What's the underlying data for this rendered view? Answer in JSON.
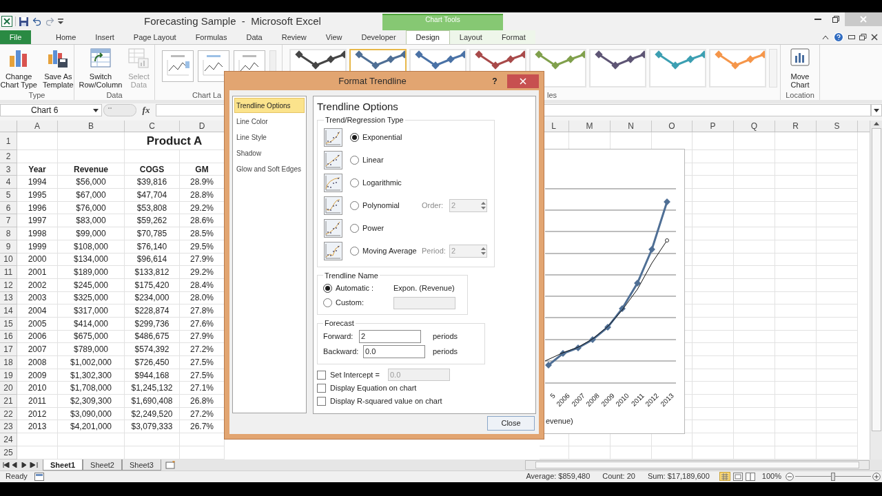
{
  "window": {
    "title": "Forecasting Sample  -  Microsoft Excel",
    "contextual_label": "Chart Tools"
  },
  "ribbon": {
    "tabs": [
      {
        "label": "File",
        "kind": "file",
        "selected": false
      },
      {
        "label": "Home",
        "kind": "plain",
        "selected": false
      },
      {
        "label": "Insert",
        "kind": "plain",
        "selected": false
      },
      {
        "label": "Page Layout",
        "kind": "plain",
        "selected": false
      },
      {
        "label": "Formulas",
        "kind": "plain",
        "selected": false
      },
      {
        "label": "Data",
        "kind": "plain",
        "selected": false
      },
      {
        "label": "Review",
        "kind": "plain",
        "selected": false
      },
      {
        "label": "View",
        "kind": "plain",
        "selected": false
      },
      {
        "label": "Developer",
        "kind": "plain",
        "selected": false
      },
      {
        "label": "Design",
        "kind": "contextual",
        "selected": true
      },
      {
        "label": "Layout",
        "kind": "contextual",
        "selected": false
      },
      {
        "label": "Format",
        "kind": "contextual",
        "selected": false
      }
    ],
    "groups": [
      {
        "label": "Type",
        "kind": "buttons",
        "buttons": [
          {
            "lines": [
              "Change",
              "Chart Type"
            ],
            "disabled": false
          },
          {
            "lines": [
              "Save As",
              "Template"
            ],
            "disabled": false
          }
        ]
      },
      {
        "label": "Data",
        "kind": "buttons",
        "buttons": [
          {
            "lines": [
              "Switch",
              "Row/Column"
            ],
            "disabled": false
          },
          {
            "lines": [
              "Select",
              "Data"
            ],
            "disabled": true
          }
        ]
      },
      {
        "label": "Chart La",
        "kind": "layouts"
      },
      {
        "label": "les",
        "kind": "styles",
        "styles": [
          {
            "color": "#454545",
            "selected": false
          },
          {
            "color": "#4f6f95",
            "selected": true
          },
          {
            "color": "#4a72a6",
            "selected": false
          },
          {
            "color": "#a84a4a",
            "selected": false
          },
          {
            "color": "#80a04c",
            "selected": false
          },
          {
            "color": "#5e5575",
            "selected": false
          },
          {
            "color": "#3c9fb2",
            "selected": false
          },
          {
            "color": "#f5964a",
            "selected": false
          }
        ]
      },
      {
        "label": "Location",
        "kind": "buttons",
        "buttons": [
          {
            "lines": [
              "Move",
              "Chart"
            ],
            "disabled": false
          }
        ]
      }
    ]
  },
  "formula_bar": {
    "name_box": "Chart 6",
    "function_label": "fx"
  },
  "sheet": {
    "columns_left": [
      "A",
      "B",
      "C",
      "D"
    ],
    "columns_right": [
      "L",
      "M",
      "N",
      "O",
      "P",
      "Q",
      "R",
      "S"
    ],
    "row_numbers": [
      "1",
      "2",
      "3",
      "4",
      "5",
      "6",
      "7",
      "8",
      "9",
      "10",
      "11",
      "12",
      "13",
      "14",
      "15",
      "16",
      "17",
      "18",
      "19",
      "20",
      "21",
      "22",
      "23",
      "24",
      "25"
    ],
    "title": "Product A",
    "header": [
      "Year",
      "Revenue",
      "COGS",
      "GM"
    ],
    "data": [
      [
        "1994",
        "$56,000",
        "$39,816",
        "28.9%"
      ],
      [
        "1995",
        "$67,000",
        "$47,704",
        "28.8%"
      ],
      [
        "1996",
        "$76,000",
        "$53,808",
        "29.2%"
      ],
      [
        "1997",
        "$83,000",
        "$59,262",
        "28.6%"
      ],
      [
        "1998",
        "$99,000",
        "$70,785",
        "28.5%"
      ],
      [
        "1999",
        "$108,000",
        "$76,140",
        "29.5%"
      ],
      [
        "2000",
        "$134,000",
        "$96,614",
        "27.9%"
      ],
      [
        "2001",
        "$189,000",
        "$133,812",
        "29.2%"
      ],
      [
        "2002",
        "$245,000",
        "$175,420",
        "28.4%"
      ],
      [
        "2003",
        "$325,000",
        "$234,000",
        "28.0%"
      ],
      [
        "2004",
        "$317,000",
        "$228,874",
        "27.8%"
      ],
      [
        "2005",
        "$414,000",
        "$299,736",
        "27.6%"
      ],
      [
        "2006",
        "$675,000",
        "$486,675",
        "27.9%"
      ],
      [
        "2007",
        "$789,000",
        "$574,392",
        "27.2%"
      ],
      [
        "2008",
        "$1,002,000",
        "$726,450",
        "27.5%"
      ],
      [
        "2009",
        "$1,302,300",
        "$944,168",
        "27.5%"
      ],
      [
        "2010",
        "$1,708,000",
        "$1,245,132",
        "27.1%"
      ],
      [
        "2011",
        "$2,309,300",
        "$1,690,408",
        "26.8%"
      ],
      [
        "2012",
        "$3,090,000",
        "$2,249,520",
        "27.2%"
      ],
      [
        "2013",
        "$4,201,000",
        "$3,079,333",
        "26.7%"
      ]
    ]
  },
  "chart": {
    "x_labels": [
      "5",
      "2006",
      "2007",
      "2008",
      "2009",
      "2010",
      "2011",
      "2012",
      "2013"
    ],
    "legend": "evenue)"
  },
  "dialog": {
    "title": "Format Trendline",
    "help": "?",
    "nav": [
      {
        "label": "Trendline Options",
        "selected": true
      },
      {
        "label": "Line Color",
        "selected": false
      },
      {
        "label": "Line Style",
        "selected": false
      },
      {
        "label": "Shadow",
        "selected": false
      },
      {
        "label": "Glow and Soft Edges",
        "selected": false
      }
    ],
    "heading": "Trendline Options",
    "type_group": "Trend/Regression Type",
    "trend_types": [
      {
        "label": "Exponential",
        "selected": true
      },
      {
        "label": "Linear",
        "selected": false
      },
      {
        "label": "Logarithmic",
        "selected": false
      },
      {
        "label": "Polynomial",
        "selected": false,
        "param": {
          "label": "Order:",
          "value": "2",
          "disabled": true
        }
      },
      {
        "label": "Power",
        "selected": false
      },
      {
        "label": "Moving Average",
        "selected": false,
        "param": {
          "label": "Period:",
          "value": "2",
          "disabled": true
        }
      }
    ],
    "name_group": "Trendline Name",
    "name_options": [
      {
        "label": "Automatic :",
        "selected": true,
        "kind": "text",
        "value": "Expon. (Revenue)"
      },
      {
        "label": "Custom:",
        "selected": false,
        "kind": "field",
        "disabled": true
      }
    ],
    "forecast_group": "Forecast",
    "forecast": [
      {
        "label": "Forward:",
        "value": "2",
        "unit": "periods"
      },
      {
        "label": "Backward:",
        "value": "0.0",
        "unit": "periods"
      }
    ],
    "checks": [
      {
        "label": "Set Intercept =",
        "checked": false,
        "field": {
          "value": "0.0",
          "disabled": true
        }
      },
      {
        "label": "Display Equation on chart",
        "checked": false
      },
      {
        "label": "Display R-squared value on chart",
        "checked": false
      }
    ],
    "close": "Close"
  },
  "sheet_tabs": [
    {
      "label": "Sheet1",
      "selected": true
    },
    {
      "label": "Sheet2",
      "selected": false
    },
    {
      "label": "Sheet3",
      "selected": false
    }
  ],
  "status_bar": {
    "mode": "Ready",
    "average": "Average: $859,480",
    "count": "Count: 20",
    "sum": "Sum: $17,189,600",
    "zoom": "100%",
    "zoom_slider": {
      "level": 0.5
    }
  }
}
